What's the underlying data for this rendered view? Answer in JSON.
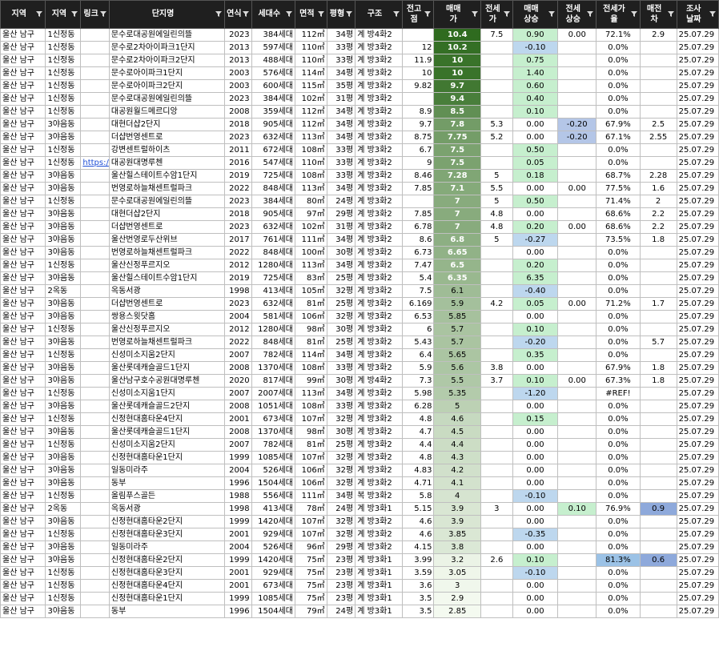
{
  "columns": [
    "지역",
    "지역",
    "링크",
    "단지명",
    "연식",
    "세대수",
    "면적",
    "평형",
    "구조",
    "전고점",
    "매매가",
    "전세가",
    "매매상승",
    "전세상승",
    "전세가율",
    "매전차",
    "조사날짜"
  ],
  "rows": [
    [
      "울산 남구",
      "1신정동",
      "",
      "문수로대공원에일린의뜰",
      "2023",
      "384세대",
      "112㎡",
      "34평",
      "계 방4화2",
      "",
      "10.4",
      "7.5",
      "0.90",
      "0.00",
      "72.1%",
      "2.9",
      "25.07.29"
    ],
    [
      "울산 남구",
      "1신정동",
      "",
      "문수로2차아이파크1단지",
      "2013",
      "597세대",
      "110㎡",
      "33평",
      "계 방3화2",
      "12",
      "10.2",
      "",
      "-0.10",
      "",
      "0.0%",
      "",
      "25.07.29"
    ],
    [
      "울산 남구",
      "1신정동",
      "",
      "문수로2차아이파크2단지",
      "2013",
      "488세대",
      "110㎡",
      "33평",
      "계 방3화2",
      "11.9",
      "10",
      "",
      "0.75",
      "",
      "0.0%",
      "",
      "25.07.29"
    ],
    [
      "울산 남구",
      "1신정동",
      "",
      "문수로아이파크1단지",
      "2003",
      "576세대",
      "114㎡",
      "34평",
      "계 방3화2",
      "10",
      "10",
      "",
      "1.40",
      "",
      "0.0%",
      "",
      "25.07.29"
    ],
    [
      "울산 남구",
      "1신정동",
      "",
      "문수로아이파크2단지",
      "2003",
      "600세대",
      "115㎡",
      "35평",
      "계 방3화2",
      "9.82",
      "9.7",
      "",
      "0.60",
      "",
      "0.0%",
      "",
      "25.07.29"
    ],
    [
      "울산 남구",
      "1신정동",
      "",
      "문수로대공원에일린의뜰",
      "2023",
      "384세대",
      "102㎡",
      "31평",
      "계 방3화2",
      "",
      "9.4",
      "",
      "0.40",
      "",
      "0.0%",
      "",
      "25.07.29"
    ],
    [
      "울산 남구",
      "1신정동",
      "",
      "대공원월드메르디앙",
      "2008",
      "359세대",
      "112㎡",
      "34평",
      "계 방3화2",
      "8.9",
      "8.5",
      "",
      "0.10",
      "",
      "0.0%",
      "",
      "25.07.29"
    ],
    [
      "울산 남구",
      "3야음동",
      "",
      "대현더샵2단지",
      "2018",
      "905세대",
      "112㎡",
      "34평",
      "계 방3화2",
      "9.7",
      "7.8",
      "5.3",
      "0.00",
      "-0.20",
      "67.9%",
      "2.5",
      "25.07.29"
    ],
    [
      "울산 남구",
      "3야음동",
      "",
      "더샵번영센트로",
      "2023",
      "632세대",
      "113㎡",
      "34평",
      "계 방3화2",
      "8.75",
      "7.75",
      "5.2",
      "0.00",
      "-0.20",
      "67.1%",
      "2.55",
      "25.07.29"
    ],
    [
      "울산 남구",
      "1신정동",
      "",
      "강변센트럴하이츠",
      "2011",
      "672세대",
      "108㎡",
      "33평",
      "계 방3화2",
      "6.7",
      "7.5",
      "",
      "0.50",
      "",
      "0.0%",
      "",
      "25.07.29"
    ],
    [
      "울산 남구",
      "1신정동",
      "https:/",
      "대공원대명루첸",
      "2016",
      "547세대",
      "110㎡",
      "33평",
      "계 방3화2",
      "9",
      "7.5",
      "",
      "0.05",
      "",
      "0.0%",
      "",
      "25.07.29"
    ],
    [
      "울산 남구",
      "3야음동",
      "",
      "울산힐스테이트수암1단지",
      "2019",
      "725세대",
      "108㎡",
      "33평",
      "계 방3화2",
      "8.46",
      "7.28",
      "5",
      "0.18",
      "",
      "68.7%",
      "2.28",
      "25.07.29"
    ],
    [
      "울산 남구",
      "3야음동",
      "",
      "번영로하늘채센트럴파크",
      "2022",
      "848세대",
      "113㎡",
      "34평",
      "계 방3화2",
      "7.85",
      "7.1",
      "5.5",
      "0.00",
      "0.00",
      "77.5%",
      "1.6",
      "25.07.29"
    ],
    [
      "울산 남구",
      "1신정동",
      "",
      "문수로대공원에일린의뜰",
      "2023",
      "384세대",
      "80㎡",
      "24평",
      "계 방3화2",
      "",
      "7",
      "5",
      "0.50",
      "",
      "71.4%",
      "2",
      "25.07.29"
    ],
    [
      "울산 남구",
      "3야음동",
      "",
      "대현더샵2단지",
      "2018",
      "905세대",
      "97㎡",
      "29평",
      "계 방3화2",
      "7.85",
      "7",
      "4.8",
      "0.00",
      "",
      "68.6%",
      "2.2",
      "25.07.29"
    ],
    [
      "울산 남구",
      "3야음동",
      "",
      "더샵번영센트로",
      "2023",
      "632세대",
      "102㎡",
      "31평",
      "계 방3화2",
      "6.78",
      "7",
      "4.8",
      "0.20",
      "0.00",
      "68.6%",
      "2.2",
      "25.07.29"
    ],
    [
      "울산 남구",
      "3야음동",
      "",
      "울산번영로두산위브",
      "2017",
      "761세대",
      "111㎡",
      "34평",
      "계 방3화2",
      "8.6",
      "6.8",
      "5",
      "-0.27",
      "",
      "73.5%",
      "1.8",
      "25.07.29"
    ],
    [
      "울산 남구",
      "3야음동",
      "",
      "번영로하늘채센트럴파크",
      "2022",
      "848세대",
      "100㎡",
      "30평",
      "계 방3화2",
      "6.73",
      "6.65",
      "",
      "0.00",
      "",
      "0.0%",
      "",
      "25.07.29"
    ],
    [
      "울산 남구",
      "1신정동",
      "",
      "울산신정푸르지오",
      "2012",
      "1280세대",
      "113㎡",
      "34평",
      "계 방3화2",
      "7.47",
      "6.5",
      "",
      "0.20",
      "",
      "0.0%",
      "",
      "25.07.29"
    ],
    [
      "울산 남구",
      "3야음동",
      "",
      "울산힐스테이트수암1단지",
      "2019",
      "725세대",
      "83㎡",
      "25평",
      "계 방3화2",
      "5.4",
      "6.35",
      "",
      "6.35",
      "",
      "0.0%",
      "",
      "25.07.29"
    ],
    [
      "울산 남구",
      "2옥동",
      "",
      "옥동서광",
      "1998",
      "413세대",
      "105㎡",
      "32평",
      "계 방3화2",
      "7.5",
      "6.1",
      "",
      "-0.40",
      "",
      "0.0%",
      "",
      "25.07.29"
    ],
    [
      "울산 남구",
      "3야음동",
      "",
      "더샵번영센트로",
      "2023",
      "632세대",
      "81㎡",
      "25평",
      "계 방3화2",
      "6.169",
      "5.9",
      "4.2",
      "0.05",
      "0.00",
      "71.2%",
      "1.7",
      "25.07.29"
    ],
    [
      "울산 남구",
      "3야음동",
      "",
      "쌍용스윗닷홈",
      "2004",
      "581세대",
      "106㎡",
      "32평",
      "계 방3화2",
      "6.53",
      "5.85",
      "",
      "0.00",
      "",
      "0.0%",
      "",
      "25.07.29"
    ],
    [
      "울산 남구",
      "1신정동",
      "",
      "울산신정푸르지오",
      "2012",
      "1280세대",
      "98㎡",
      "30평",
      "계 방3화2",
      "6",
      "5.7",
      "",
      "0.10",
      "",
      "0.0%",
      "",
      "25.07.29"
    ],
    [
      "울산 남구",
      "3야음동",
      "",
      "번영로하늘채센트럴파크",
      "2022",
      "848세대",
      "81㎡",
      "25평",
      "계 방3화2",
      "5.43",
      "5.7",
      "",
      "-0.20",
      "",
      "0.0%",
      "5.7",
      "25.07.29"
    ],
    [
      "울산 남구",
      "1신정동",
      "",
      "신성미소지움2단지",
      "2007",
      "782세대",
      "114㎡",
      "34평",
      "계 방3화2",
      "6.4",
      "5.65",
      "",
      "0.35",
      "",
      "0.0%",
      "",
      "25.07.29"
    ],
    [
      "울산 남구",
      "3야음동",
      "",
      "울산롯데캐슬골드1단지",
      "2008",
      "1370세대",
      "108㎡",
      "33평",
      "계 방3화2",
      "5.9",
      "5.6",
      "3.8",
      "0.00",
      "",
      "67.9%",
      "1.8",
      "25.07.29"
    ],
    [
      "울산 남구",
      "3야음동",
      "",
      "울산남구호수공원대명루첸",
      "2020",
      "817세대",
      "99㎡",
      "30평",
      "계 방4화2",
      "7.3",
      "5.5",
      "3.7",
      "0.10",
      "0.00",
      "67.3%",
      "1.8",
      "25.07.29"
    ],
    [
      "울산 남구",
      "1신정동",
      "",
      "신성미소지움1단지",
      "2007",
      "2007세대",
      "113㎡",
      "34평",
      "계 방3화2",
      "5.98",
      "5.35",
      "",
      "-1.20",
      "",
      "#REF!",
      "",
      "25.07.29"
    ],
    [
      "울산 남구",
      "3야음동",
      "",
      "울산롯데캐슬골드2단지",
      "2008",
      "1051세대",
      "108㎡",
      "33평",
      "계 방3화2",
      "6.28",
      "5",
      "",
      "0.00",
      "",
      "0.0%",
      "",
      "25.07.29"
    ],
    [
      "울산 남구",
      "1신정동",
      "",
      "신정현대홈타운4단지",
      "2001",
      "673세대",
      "107㎡",
      "32평",
      "계 방3화2",
      "4.8",
      "4.6",
      "",
      "0.15",
      "",
      "0.0%",
      "",
      "25.07.29"
    ],
    [
      "울산 남구",
      "3야음동",
      "",
      "울산롯데캐슬골드1단지",
      "2008",
      "1370세대",
      "98㎡",
      "30평",
      "계 방3화2",
      "4.7",
      "4.5",
      "",
      "0.00",
      "",
      "0.0%",
      "",
      "25.07.29"
    ],
    [
      "울산 남구",
      "1신정동",
      "",
      "신성미소지움2단지",
      "2007",
      "782세대",
      "81㎡",
      "25평",
      "계 방3화2",
      "4.4",
      "4.4",
      "",
      "0.00",
      "",
      "0.0%",
      "",
      "25.07.29"
    ],
    [
      "울산 남구",
      "3야음동",
      "",
      "신정현대홈타운1단지",
      "1999",
      "1085세대",
      "107㎡",
      "32평",
      "계 방3화2",
      "4.8",
      "4.3",
      "",
      "0.00",
      "",
      "0.0%",
      "",
      "25.07.29"
    ],
    [
      "울산 남구",
      "3야음동",
      "",
      "일동미라주",
      "2004",
      "526세대",
      "106㎡",
      "32평",
      "계 방3화2",
      "4.83",
      "4.2",
      "",
      "0.00",
      "",
      "0.0%",
      "",
      "25.07.29"
    ],
    [
      "울산 남구",
      "3야음동",
      "",
      "동부",
      "1996",
      "1504세대",
      "106㎡",
      "32평",
      "계 방3화2",
      "4.71",
      "4.1",
      "",
      "0.00",
      "",
      "0.0%",
      "",
      "25.07.29"
    ],
    [
      "울산 남구",
      "1신정동",
      "",
      "올림푸스골든",
      "1988",
      "556세대",
      "111㎡",
      "34평",
      "복 방3화2",
      "5.8",
      "4",
      "",
      "-0.10",
      "",
      "0.0%",
      "",
      "25.07.29"
    ],
    [
      "울산 남구",
      "2옥동",
      "",
      "옥동서광",
      "1998",
      "413세대",
      "78㎡",
      "24평",
      "계 방3화1",
      "5.15",
      "3.9",
      "3",
      "0.00",
      "0.10",
      "76.9%",
      "0.9",
      "25.07.29"
    ],
    [
      "울산 남구",
      "3야음동",
      "",
      "신정현대홈타운2단지",
      "1999",
      "1420세대",
      "107㎡",
      "32평",
      "계 방3화2",
      "4.6",
      "3.9",
      "",
      "0.00",
      "",
      "0.0%",
      "",
      "25.07.29"
    ],
    [
      "울산 남구",
      "1신정동",
      "",
      "신정현대홈타운3단지",
      "2001",
      "929세대",
      "107㎡",
      "32평",
      "계 방3화2",
      "4.6",
      "3.85",
      "",
      "-0.35",
      "",
      "0.0%",
      "",
      "25.07.29"
    ],
    [
      "울산 남구",
      "3야음동",
      "",
      "일동미라주",
      "2004",
      "526세대",
      "96㎡",
      "29평",
      "계 방3화2",
      "4.15",
      "3.8",
      "",
      "0.00",
      "",
      "0.0%",
      "",
      "25.07.29"
    ],
    [
      "울산 남구",
      "3야음동",
      "",
      "신정현대홈타운2단지",
      "1999",
      "1420세대",
      "75㎡",
      "23평",
      "계 방3화1",
      "3.99",
      "3.2",
      "2.6",
      "0.10",
      "",
      "81.3%",
      "0.6",
      "25.07.29"
    ],
    [
      "울산 남구",
      "1신정동",
      "",
      "신정현대홈타운3단지",
      "2001",
      "929세대",
      "75㎡",
      "23평",
      "계 방3화1",
      "3.59",
      "3.05",
      "",
      "-0.10",
      "",
      "0.0%",
      "",
      "25.07.29"
    ],
    [
      "울산 남구",
      "1신정동",
      "",
      "신정현대홈타운4단지",
      "2001",
      "673세대",
      "75㎡",
      "23평",
      "계 방3화1",
      "3.6",
      "3",
      "",
      "0.00",
      "",
      "0.0%",
      "",
      "25.07.29"
    ],
    [
      "울산 남구",
      "1신정동",
      "",
      "신정현대홈타운1단지",
      "1999",
      "1085세대",
      "75㎡",
      "23평",
      "계 방3화1",
      "3.5",
      "2.9",
      "",
      "0.00",
      "",
      "0.0%",
      "",
      "25.07.29"
    ],
    [
      "울산 남구",
      "3야음동",
      "",
      "동부",
      "1996",
      "1504세대",
      "79㎡",
      "24평",
      "계 방3화1",
      "3.5",
      "2.85",
      "",
      "0.00",
      "",
      "0.0%",
      "",
      "25.07.29"
    ]
  ],
  "colors": {
    "header_bg": "#1f1f1f",
    "header_text": "#ffffff",
    "gridline": "#bfbfbf",
    "sale_price_scale_high": "#2f6b1f",
    "sale_price_scale_low": "#f4faf0",
    "rise_fill": "#c6efce",
    "fall_fill": "#bdd7ee",
    "jeonse_rise_fill": "#c6efce",
    "jeonse_fall_fill": "#b4c6e7",
    "gap_fill": "#8ea9db",
    "rate_fill": "#9bc2e6",
    "link_color": "#1f4fd6"
  },
  "icons": [
    "filter-dropdown-icon"
  ]
}
